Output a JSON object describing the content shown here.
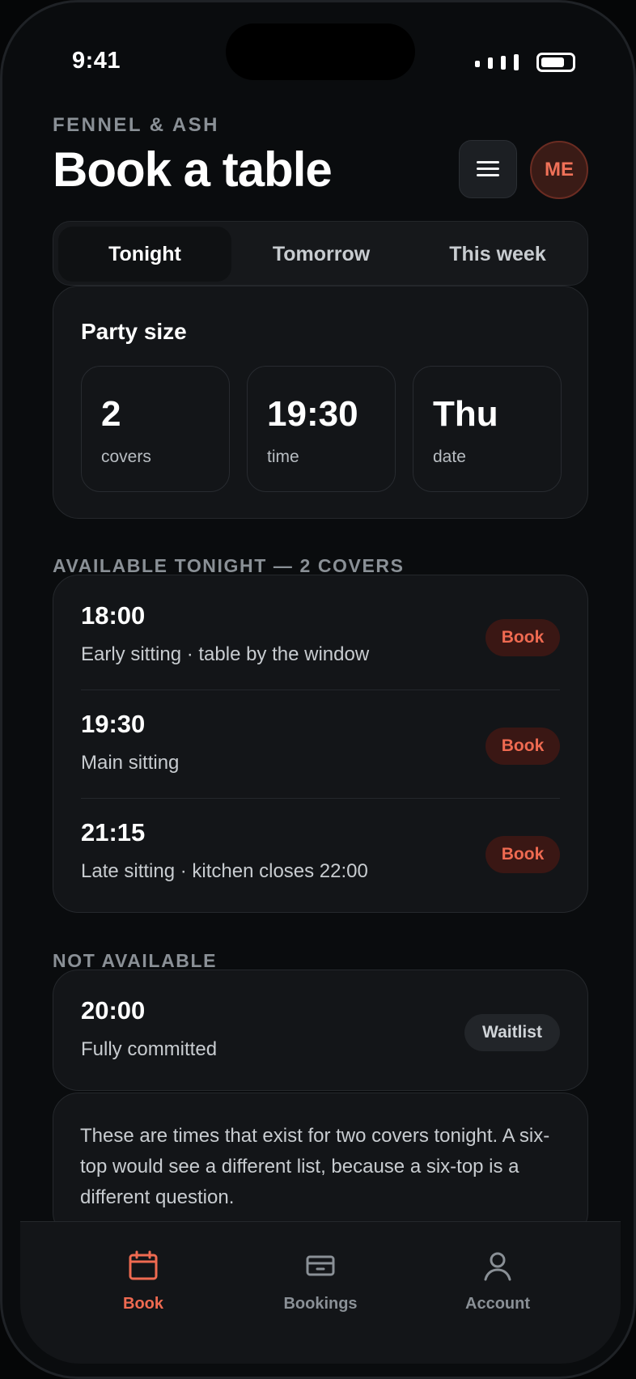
{
  "status_bar": {
    "time": "9:41"
  },
  "header": {
    "brand": "FENNEL & ASH",
    "title": "Book a table",
    "avatar_initials": "ME"
  },
  "tabs": [
    {
      "label": "Tonight",
      "active": true
    },
    {
      "label": "Tomorrow",
      "active": false
    },
    {
      "label": "This week",
      "active": false
    }
  ],
  "party": {
    "title": "Party size",
    "stats": [
      {
        "value": "2",
        "label": "covers"
      },
      {
        "value": "19:30",
        "label": "time"
      },
      {
        "value": "Thu",
        "label": "date"
      }
    ]
  },
  "available": {
    "heading": "AVAILABLE TONIGHT — 2 COVERS",
    "slots": [
      {
        "time": "18:00",
        "desc": "Early sitting · table by the window",
        "action": "Book"
      },
      {
        "time": "19:30",
        "desc": "Main sitting",
        "action": "Book"
      },
      {
        "time": "21:15",
        "desc": "Late sitting · kitchen closes 22:00",
        "action": "Book"
      }
    ]
  },
  "unavailable": {
    "heading": "NOT AVAILABLE",
    "slots": [
      {
        "time": "20:00",
        "desc": "Fully committed",
        "action": "Waitlist"
      }
    ]
  },
  "note": "These are times that exist for two covers tonight. A six-top would see a different list, because a six-top is a different question.",
  "bottom_nav": [
    {
      "label": "Book",
      "icon": "calendar-icon",
      "active": true
    },
    {
      "label": "Bookings",
      "icon": "card-icon",
      "active": false
    },
    {
      "label": "Account",
      "icon": "person-icon",
      "active": false
    }
  ],
  "colors": {
    "accent": "#ef6a51",
    "background": "#0a0c0e",
    "card": "#131518"
  }
}
